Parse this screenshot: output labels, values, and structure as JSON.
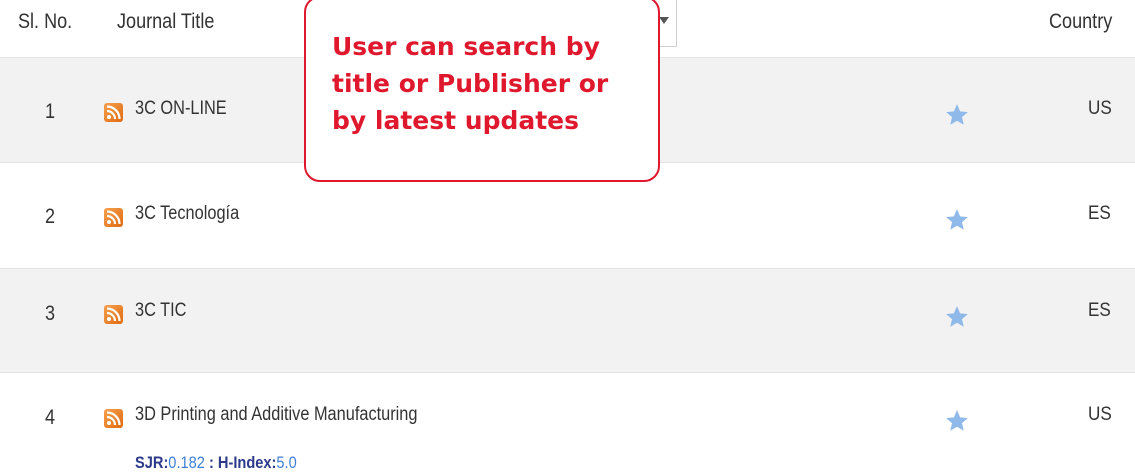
{
  "table": {
    "headers": {
      "sl_no": "Sl. No.",
      "journal_title": "Journal Title",
      "country": "Country"
    },
    "rows": [
      {
        "num": "1",
        "title": "3C ON-LINE",
        "country": "US"
      },
      {
        "num": "2",
        "title": "3C Tecnología",
        "country": "ES"
      },
      {
        "num": "3",
        "title": "3C TIC",
        "country": "ES"
      },
      {
        "num": "4",
        "title": "3D Printing and Additive Manufacturing",
        "country": "US",
        "metrics": {
          "sjr_label": "SJR:",
          "sjr_value": "0.182",
          "separator": " : ",
          "hindex_label": "H-Index:",
          "hindex_value": "5.0"
        }
      }
    ]
  },
  "callout": {
    "text": "User can search by\ntitle or Publisher or\nby latest updates"
  },
  "icons": {
    "feed": "rss-feed-icon",
    "favorite": "star-icon",
    "dropdown": "chevron-down-icon"
  },
  "colors": {
    "row_alt": "#f2f2f2",
    "callout_red": "#e0182d",
    "star_blue": "#8fb9e8",
    "rss_orange": "#e87a1f",
    "sjr_label": "#2b3a8a",
    "sjr_value": "#3d7fd6"
  }
}
